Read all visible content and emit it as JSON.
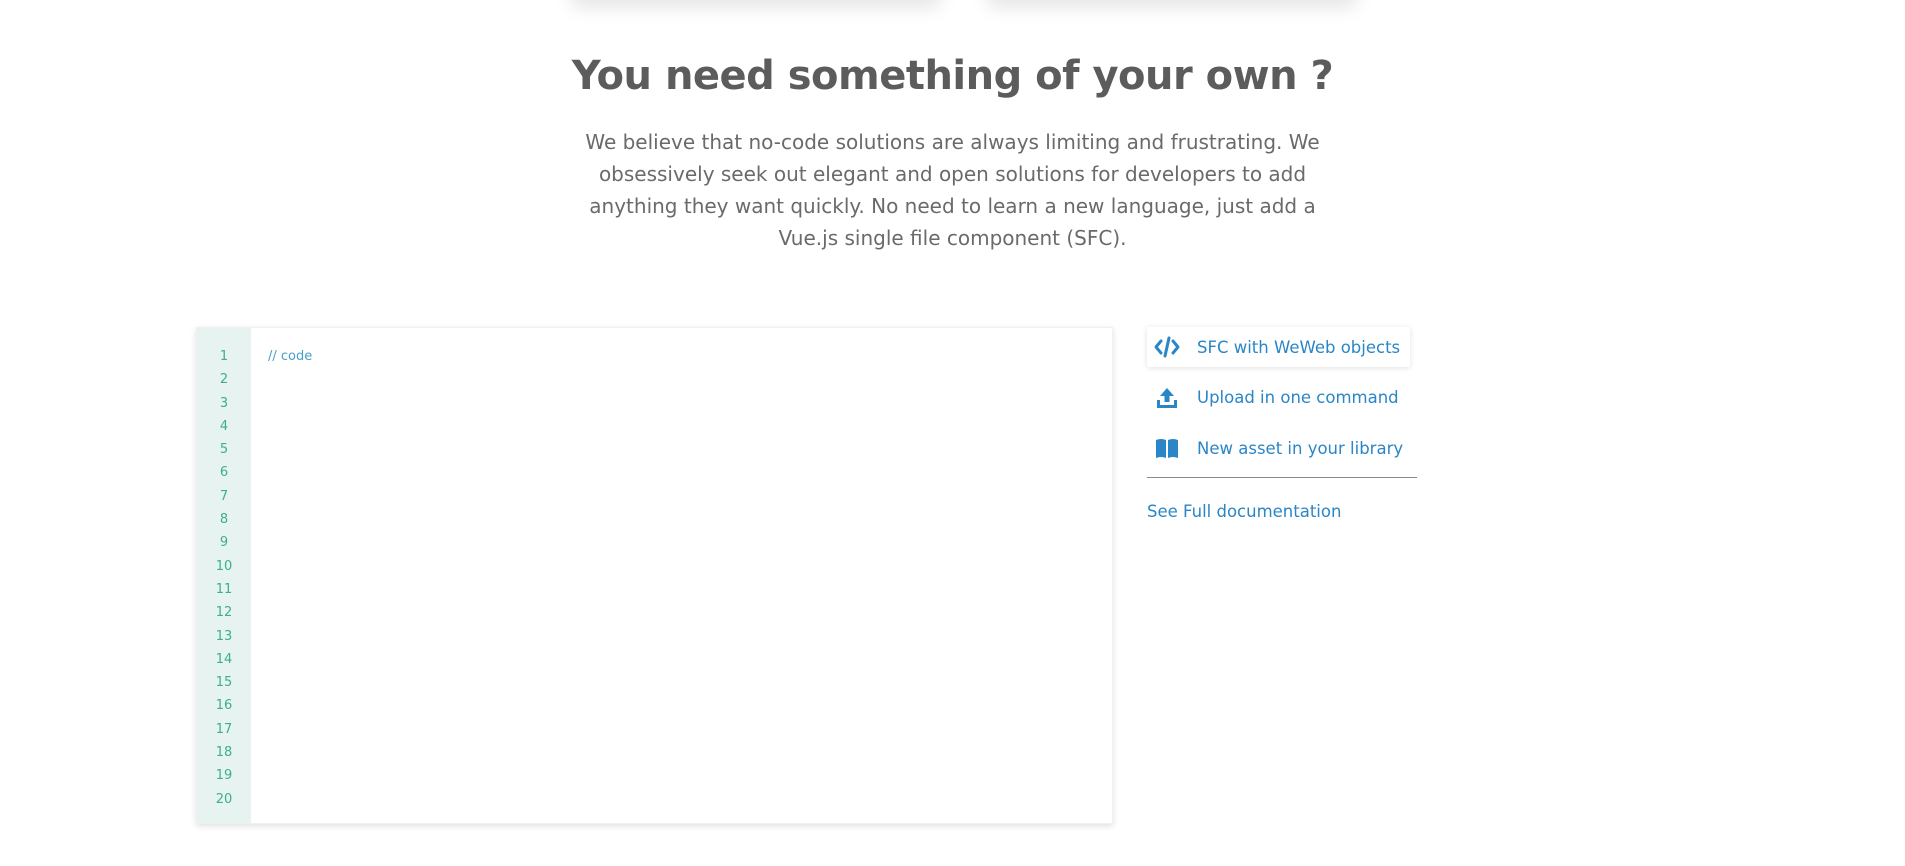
{
  "colors": {
    "accent": "#2a86c6",
    "gutter_bg": "#e6f3f0",
    "line_number": "#3daf8a",
    "text": "#5c5c5c"
  },
  "section": {
    "title": "You need something of your own ?",
    "description": "We believe that no-code solutions are always limiting and frustrating. We obsessively seek out elegant and open solutions for developers to add anything they want quickly. No need to learn a new language, just add a Vue.js single file component (SFC)."
  },
  "editor": {
    "line_numbers": [
      "1",
      "2",
      "3",
      "4",
      "5",
      "6",
      "7",
      "8",
      "9",
      "10",
      "11",
      "12",
      "13",
      "14",
      "15",
      "16",
      "17",
      "18",
      "19",
      "20"
    ],
    "code_lines": [
      "// code"
    ]
  },
  "features": {
    "items": [
      {
        "label": "SFC with WeWeb objects",
        "icon": "code-icon",
        "active": true
      },
      {
        "label": "Upload in one command",
        "icon": "upload-icon",
        "active": false
      },
      {
        "label": "New asset in your library",
        "icon": "book-icon",
        "active": false
      }
    ],
    "doc_link": "See Full documentation"
  }
}
